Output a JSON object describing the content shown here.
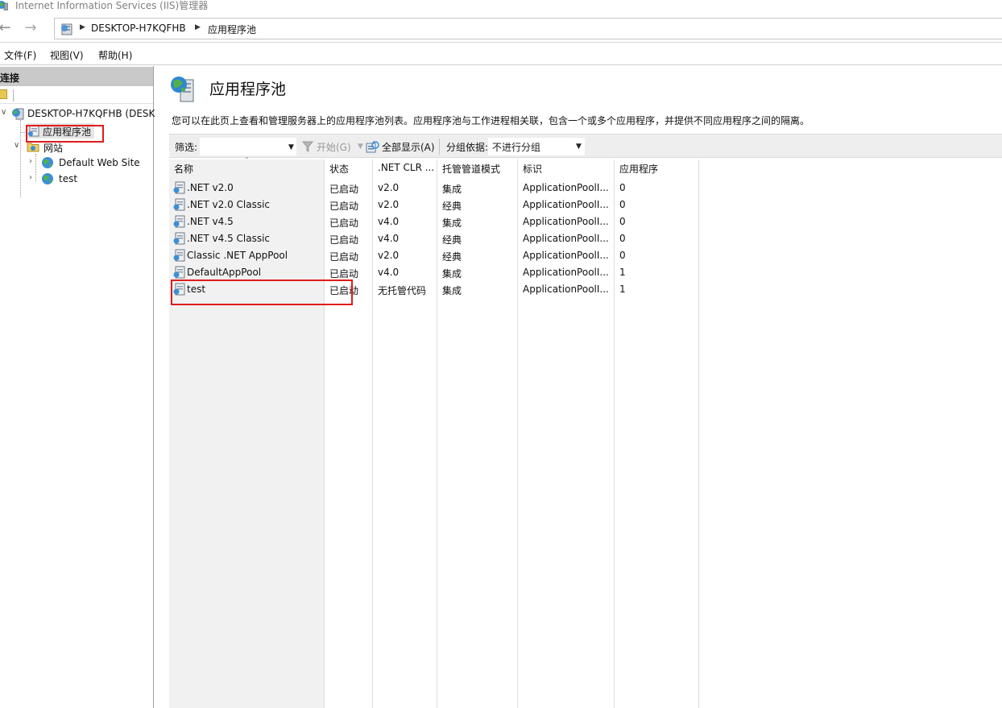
{
  "window": {
    "title": "Internet Information Services (IIS)管理器"
  },
  "address": {
    "crumbs": [
      "DESKTOP-H7KQFHB",
      "应用程序池"
    ]
  },
  "menu": {
    "items": [
      "文件(F)",
      "视图(V)",
      "帮助(H)"
    ]
  },
  "connections": {
    "header": "连接",
    "tree": [
      {
        "label": "DESKTOP-H7KQFHB (DESK",
        "icon": "server-icon",
        "expanded": true
      },
      {
        "label": "应用程序池",
        "icon": "app-pool-icon",
        "selected": true
      },
      {
        "label": "网站",
        "icon": "sites-folder-icon",
        "expanded": true
      },
      {
        "label": "Default Web Site",
        "icon": "globe-icon",
        "expanded": false
      },
      {
        "label": "test",
        "icon": "globe-icon",
        "expanded": false
      }
    ]
  },
  "main": {
    "title": "应用程序池",
    "description": "您可以在此页上查看和管理服务器上的应用程序池列表。应用程序池与工作进程相关联，包含一个或多个应用程序，并提供不同应用程序之间的隔离。",
    "filter": {
      "label": "筛选:",
      "value": "",
      "start_label": "开始(G)",
      "show_all_label": "全部显示(A)",
      "group_label": "分组依据:",
      "group_value": "不进行分组"
    },
    "columns": [
      "名称",
      "状态",
      ".NET CLR ...",
      "托管管道模式",
      "标识",
      "应用程序"
    ],
    "rows": [
      {
        "name": ".NET v2.0",
        "status": "已启动",
        "clr": "v2.0",
        "mode": "集成",
        "identity": "ApplicationPoolI...",
        "apps": "0"
      },
      {
        "name": ".NET v2.0 Classic",
        "status": "已启动",
        "clr": "v2.0",
        "mode": "经典",
        "identity": "ApplicationPoolI...",
        "apps": "0"
      },
      {
        "name": ".NET v4.5",
        "status": "已启动",
        "clr": "v4.0",
        "mode": "集成",
        "identity": "ApplicationPoolI...",
        "apps": "0"
      },
      {
        "name": ".NET v4.5 Classic",
        "status": "已启动",
        "clr": "v4.0",
        "mode": "经典",
        "identity": "ApplicationPoolI...",
        "apps": "0"
      },
      {
        "name": "Classic .NET AppPool",
        "status": "已启动",
        "clr": "v2.0",
        "mode": "经典",
        "identity": "ApplicationPoolI...",
        "apps": "0"
      },
      {
        "name": "DefaultAppPool",
        "status": "已启动",
        "clr": "v4.0",
        "mode": "集成",
        "identity": "ApplicationPoolI...",
        "apps": "1"
      },
      {
        "name": "test",
        "status": "已启动",
        "clr": "无托管代码",
        "mode": "集成",
        "identity": "ApplicationPoolI...",
        "apps": "1"
      }
    ]
  },
  "colors": {
    "annotation": "#e01b1b",
    "panel_header": "#c9c9c9",
    "selection": "#e5e5e5"
  }
}
